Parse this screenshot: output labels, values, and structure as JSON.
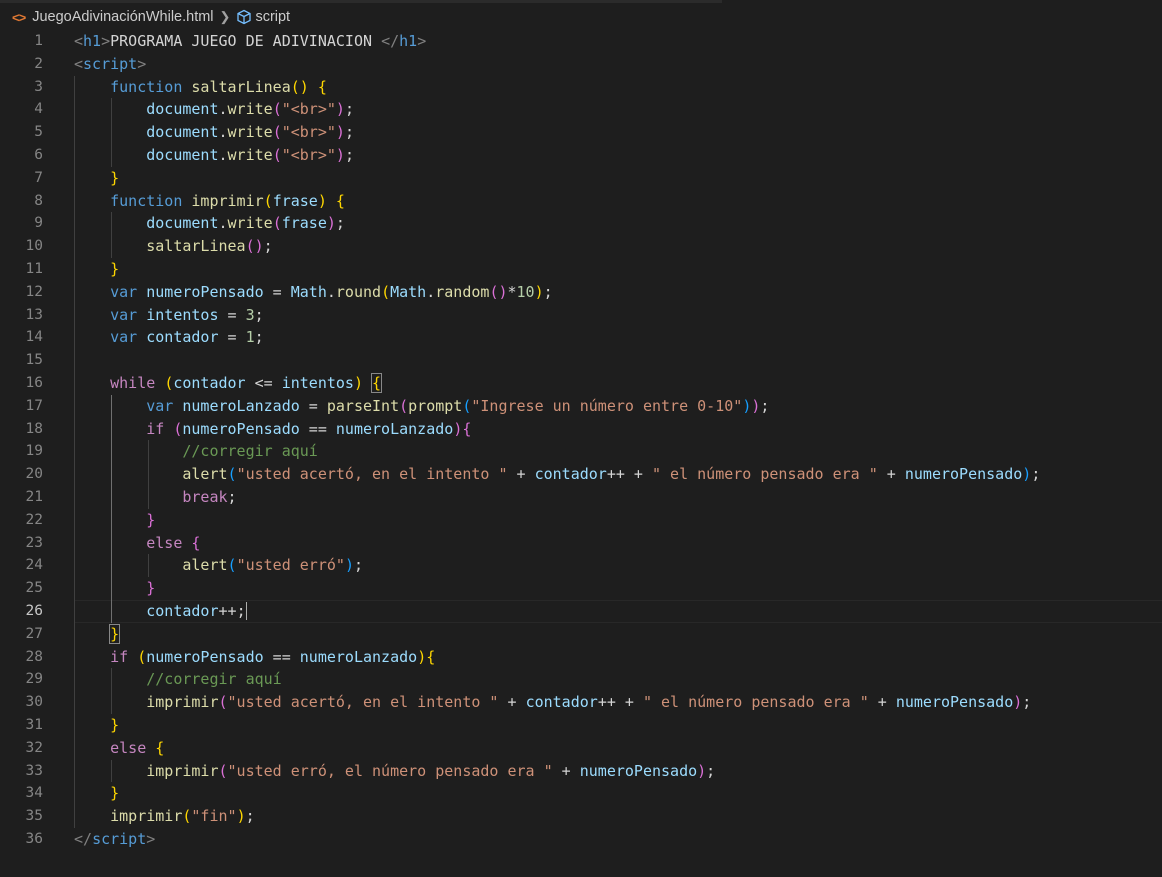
{
  "breadcrumb": {
    "file_icon": "html-icon",
    "file": "JuegoAdivinaciónWhile.html",
    "separator_icon": "chevron-right-icon",
    "symbol_icon": "cube-icon",
    "symbol": "script"
  },
  "editor": {
    "active_line": 26,
    "lines": [
      {
        "n": "1",
        "tokens": [
          [
            "t-punc",
            "<"
          ],
          [
            "t-tag",
            "h1"
          ],
          [
            "t-punc",
            ">"
          ],
          [
            "t-txt",
            "PROGRAMA JUEGO DE ADIVINACION "
          ],
          [
            "t-punc",
            "</"
          ],
          [
            "t-tag",
            "h1"
          ],
          [
            "t-punc",
            ">"
          ]
        ]
      },
      {
        "n": "2",
        "tokens": [
          [
            "t-punc",
            "<"
          ],
          [
            "t-tag",
            "script"
          ],
          [
            "t-punc",
            ">"
          ]
        ]
      },
      {
        "n": "3",
        "tokens": [
          [
            "t-txt",
            "    "
          ],
          [
            "t-kw",
            "function"
          ],
          [
            "t-txt",
            " "
          ],
          [
            "t-fn",
            "saltarLinea"
          ],
          [
            "b1",
            "()"
          ],
          [
            "t-txt",
            " "
          ],
          [
            "b1",
            "{"
          ]
        ]
      },
      {
        "n": "4",
        "tokens": [
          [
            "t-txt",
            "        "
          ],
          [
            "t-var",
            "document"
          ],
          [
            "t-txt",
            "."
          ],
          [
            "t-fn",
            "write"
          ],
          [
            "b2",
            "("
          ],
          [
            "t-str",
            "\"<br>\""
          ],
          [
            "b2",
            ")"
          ],
          [
            "t-txt",
            ";"
          ]
        ]
      },
      {
        "n": "5",
        "tokens": [
          [
            "t-txt",
            "        "
          ],
          [
            "t-var",
            "document"
          ],
          [
            "t-txt",
            "."
          ],
          [
            "t-fn",
            "write"
          ],
          [
            "b2",
            "("
          ],
          [
            "t-str",
            "\"<br>\""
          ],
          [
            "b2",
            ")"
          ],
          [
            "t-txt",
            ";"
          ]
        ]
      },
      {
        "n": "6",
        "tokens": [
          [
            "t-txt",
            "        "
          ],
          [
            "t-var",
            "document"
          ],
          [
            "t-txt",
            "."
          ],
          [
            "t-fn",
            "write"
          ],
          [
            "b2",
            "("
          ],
          [
            "t-str",
            "\"<br>\""
          ],
          [
            "b2",
            ")"
          ],
          [
            "t-txt",
            ";"
          ]
        ]
      },
      {
        "n": "7",
        "tokens": [
          [
            "t-txt",
            "    "
          ],
          [
            "b1",
            "}"
          ]
        ]
      },
      {
        "n": "8",
        "tokens": [
          [
            "t-txt",
            "    "
          ],
          [
            "t-kw",
            "function"
          ],
          [
            "t-txt",
            " "
          ],
          [
            "t-fn",
            "imprimir"
          ],
          [
            "b1",
            "("
          ],
          [
            "t-var",
            "frase"
          ],
          [
            "b1",
            ")"
          ],
          [
            "t-txt",
            " "
          ],
          [
            "b1",
            "{"
          ]
        ]
      },
      {
        "n": "9",
        "tokens": [
          [
            "t-txt",
            "        "
          ],
          [
            "t-var",
            "document"
          ],
          [
            "t-txt",
            "."
          ],
          [
            "t-fn",
            "write"
          ],
          [
            "b2",
            "("
          ],
          [
            "t-var",
            "frase"
          ],
          [
            "b2",
            ")"
          ],
          [
            "t-txt",
            ";"
          ]
        ]
      },
      {
        "n": "10",
        "tokens": [
          [
            "t-txt",
            "        "
          ],
          [
            "t-fn",
            "saltarLinea"
          ],
          [
            "b2",
            "()"
          ],
          [
            "t-txt",
            ";"
          ]
        ]
      },
      {
        "n": "11",
        "tokens": [
          [
            "t-txt",
            "    "
          ],
          [
            "b1",
            "}"
          ]
        ]
      },
      {
        "n": "12",
        "tokens": [
          [
            "t-txt",
            "    "
          ],
          [
            "t-kw",
            "var"
          ],
          [
            "t-txt",
            " "
          ],
          [
            "t-var",
            "numeroPensado"
          ],
          [
            "t-op",
            " = "
          ],
          [
            "t-var",
            "Math"
          ],
          [
            "t-txt",
            "."
          ],
          [
            "t-fn",
            "round"
          ],
          [
            "b1",
            "("
          ],
          [
            "t-var",
            "Math"
          ],
          [
            "t-txt",
            "."
          ],
          [
            "t-fn",
            "random"
          ],
          [
            "b2",
            "()"
          ],
          [
            "t-op",
            "*"
          ],
          [
            "t-num",
            "10"
          ],
          [
            "b1",
            ")"
          ],
          [
            "t-txt",
            ";"
          ]
        ]
      },
      {
        "n": "13",
        "tokens": [
          [
            "t-txt",
            "    "
          ],
          [
            "t-kw",
            "var"
          ],
          [
            "t-txt",
            " "
          ],
          [
            "t-var",
            "intentos"
          ],
          [
            "t-op",
            " = "
          ],
          [
            "t-num",
            "3"
          ],
          [
            "t-txt",
            ";"
          ]
        ]
      },
      {
        "n": "14",
        "tokens": [
          [
            "t-txt",
            "    "
          ],
          [
            "t-kw",
            "var"
          ],
          [
            "t-txt",
            " "
          ],
          [
            "t-var",
            "contador"
          ],
          [
            "t-op",
            " = "
          ],
          [
            "t-num",
            "1"
          ],
          [
            "t-txt",
            ";"
          ]
        ]
      },
      {
        "n": "15",
        "tokens": []
      },
      {
        "n": "16",
        "tokens": [
          [
            "t-txt",
            "    "
          ],
          [
            "t-ctrl",
            "while"
          ],
          [
            "t-txt",
            " "
          ],
          [
            "b1",
            "("
          ],
          [
            "t-var",
            "contador"
          ],
          [
            "t-op",
            " <= "
          ],
          [
            "t-var",
            "intentos"
          ],
          [
            "b1",
            ")"
          ],
          [
            "t-txt",
            " "
          ],
          [
            "b1",
            "{"
          ]
        ]
      },
      {
        "n": "17",
        "tokens": [
          [
            "t-txt",
            "        "
          ],
          [
            "t-kw",
            "var"
          ],
          [
            "t-txt",
            " "
          ],
          [
            "t-var",
            "numeroLanzado"
          ],
          [
            "t-op",
            " = "
          ],
          [
            "t-fn",
            "parseInt"
          ],
          [
            "b2",
            "("
          ],
          [
            "t-fn",
            "prompt"
          ],
          [
            "b3",
            "("
          ],
          [
            "t-str",
            "\"Ingrese un número entre 0-10\""
          ],
          [
            "b3",
            ")"
          ],
          [
            "b2",
            ")"
          ],
          [
            "t-txt",
            ";"
          ]
        ]
      },
      {
        "n": "18",
        "tokens": [
          [
            "t-txt",
            "        "
          ],
          [
            "t-ctrl",
            "if"
          ],
          [
            "t-txt",
            " "
          ],
          [
            "b2",
            "("
          ],
          [
            "t-var",
            "numeroPensado"
          ],
          [
            "t-op",
            " == "
          ],
          [
            "t-var",
            "numeroLanzado"
          ],
          [
            "b2",
            ")"
          ],
          [
            "b2",
            "{"
          ]
        ]
      },
      {
        "n": "19",
        "tokens": [
          [
            "t-txt",
            "            "
          ],
          [
            "t-cmt",
            "//corregir aquí"
          ]
        ]
      },
      {
        "n": "20",
        "tokens": [
          [
            "t-txt",
            "            "
          ],
          [
            "t-fn",
            "alert"
          ],
          [
            "b3",
            "("
          ],
          [
            "t-str",
            "\"usted acertó, en el intento \""
          ],
          [
            "t-op",
            " + "
          ],
          [
            "t-var",
            "contador"
          ],
          [
            "t-op",
            "++ + "
          ],
          [
            "t-str",
            "\" el número pensado era \""
          ],
          [
            "t-op",
            " + "
          ],
          [
            "t-var",
            "numeroPensado"
          ],
          [
            "b3",
            ")"
          ],
          [
            "t-txt",
            ";"
          ]
        ]
      },
      {
        "n": "21",
        "tokens": [
          [
            "t-txt",
            "            "
          ],
          [
            "t-ctrl",
            "break"
          ],
          [
            "t-txt",
            ";"
          ]
        ]
      },
      {
        "n": "22",
        "tokens": [
          [
            "t-txt",
            "        "
          ],
          [
            "b2",
            "}"
          ]
        ]
      },
      {
        "n": "23",
        "tokens": [
          [
            "t-txt",
            "        "
          ],
          [
            "t-ctrl",
            "else"
          ],
          [
            "t-txt",
            " "
          ],
          [
            "b2",
            "{"
          ]
        ]
      },
      {
        "n": "24",
        "tokens": [
          [
            "t-txt",
            "            "
          ],
          [
            "t-fn",
            "alert"
          ],
          [
            "b3",
            "("
          ],
          [
            "t-str",
            "\"usted erró\""
          ],
          [
            "b3",
            ")"
          ],
          [
            "t-txt",
            ";"
          ]
        ]
      },
      {
        "n": "25",
        "tokens": [
          [
            "t-txt",
            "        "
          ],
          [
            "b2",
            "}"
          ]
        ]
      },
      {
        "n": "26",
        "tokens": [
          [
            "t-txt",
            "        "
          ],
          [
            "t-var",
            "contador"
          ],
          [
            "t-op",
            "++"
          ],
          [
            "t-txt",
            ";"
          ]
        ]
      },
      {
        "n": "27",
        "tokens": [
          [
            "t-txt",
            "    "
          ],
          [
            "b1",
            "}"
          ]
        ]
      },
      {
        "n": "28",
        "tokens": [
          [
            "t-txt",
            "    "
          ],
          [
            "t-ctrl",
            "if"
          ],
          [
            "t-txt",
            " "
          ],
          [
            "b1",
            "("
          ],
          [
            "t-var",
            "numeroPensado"
          ],
          [
            "t-op",
            " == "
          ],
          [
            "t-var",
            "numeroLanzado"
          ],
          [
            "b1",
            ")"
          ],
          [
            "b1",
            "{"
          ]
        ]
      },
      {
        "n": "29",
        "tokens": [
          [
            "t-txt",
            "        "
          ],
          [
            "t-cmt",
            "//corregir aquí"
          ]
        ]
      },
      {
        "n": "30",
        "tokens": [
          [
            "t-txt",
            "        "
          ],
          [
            "t-fn",
            "imprimir"
          ],
          [
            "b2",
            "("
          ],
          [
            "t-str",
            "\"usted acertó, en el intento \""
          ],
          [
            "t-op",
            " + "
          ],
          [
            "t-var",
            "contador"
          ],
          [
            "t-op",
            "++ + "
          ],
          [
            "t-str",
            "\" el número pensado era \""
          ],
          [
            "t-op",
            " + "
          ],
          [
            "t-var",
            "numeroPensado"
          ],
          [
            "b2",
            ")"
          ],
          [
            "t-txt",
            ";"
          ]
        ]
      },
      {
        "n": "31",
        "tokens": [
          [
            "t-txt",
            "    "
          ],
          [
            "b1",
            "}"
          ]
        ]
      },
      {
        "n": "32",
        "tokens": [
          [
            "t-txt",
            "    "
          ],
          [
            "t-ctrl",
            "else"
          ],
          [
            "t-txt",
            " "
          ],
          [
            "b1",
            "{"
          ]
        ]
      },
      {
        "n": "33",
        "tokens": [
          [
            "t-txt",
            "        "
          ],
          [
            "t-fn",
            "imprimir"
          ],
          [
            "b2",
            "("
          ],
          [
            "t-str",
            "\"usted erró, el número pensado era \""
          ],
          [
            "t-op",
            " + "
          ],
          [
            "t-var",
            "numeroPensado"
          ],
          [
            "b2",
            ")"
          ],
          [
            "t-txt",
            ";"
          ]
        ]
      },
      {
        "n": "34",
        "tokens": [
          [
            "t-txt",
            "    "
          ],
          [
            "b1",
            "}"
          ]
        ]
      },
      {
        "n": "35",
        "tokens": [
          [
            "t-txt",
            "    "
          ],
          [
            "t-fn",
            "imprimir"
          ],
          [
            "b1",
            "("
          ],
          [
            "t-str",
            "\"fin\""
          ],
          [
            "b1",
            ")"
          ],
          [
            "t-txt",
            ";"
          ]
        ]
      },
      {
        "n": "36",
        "tokens": [
          [
            "t-punc",
            "</"
          ],
          [
            "t-tag",
            "script"
          ],
          [
            "t-punc",
            ">"
          ]
        ]
      }
    ]
  }
}
